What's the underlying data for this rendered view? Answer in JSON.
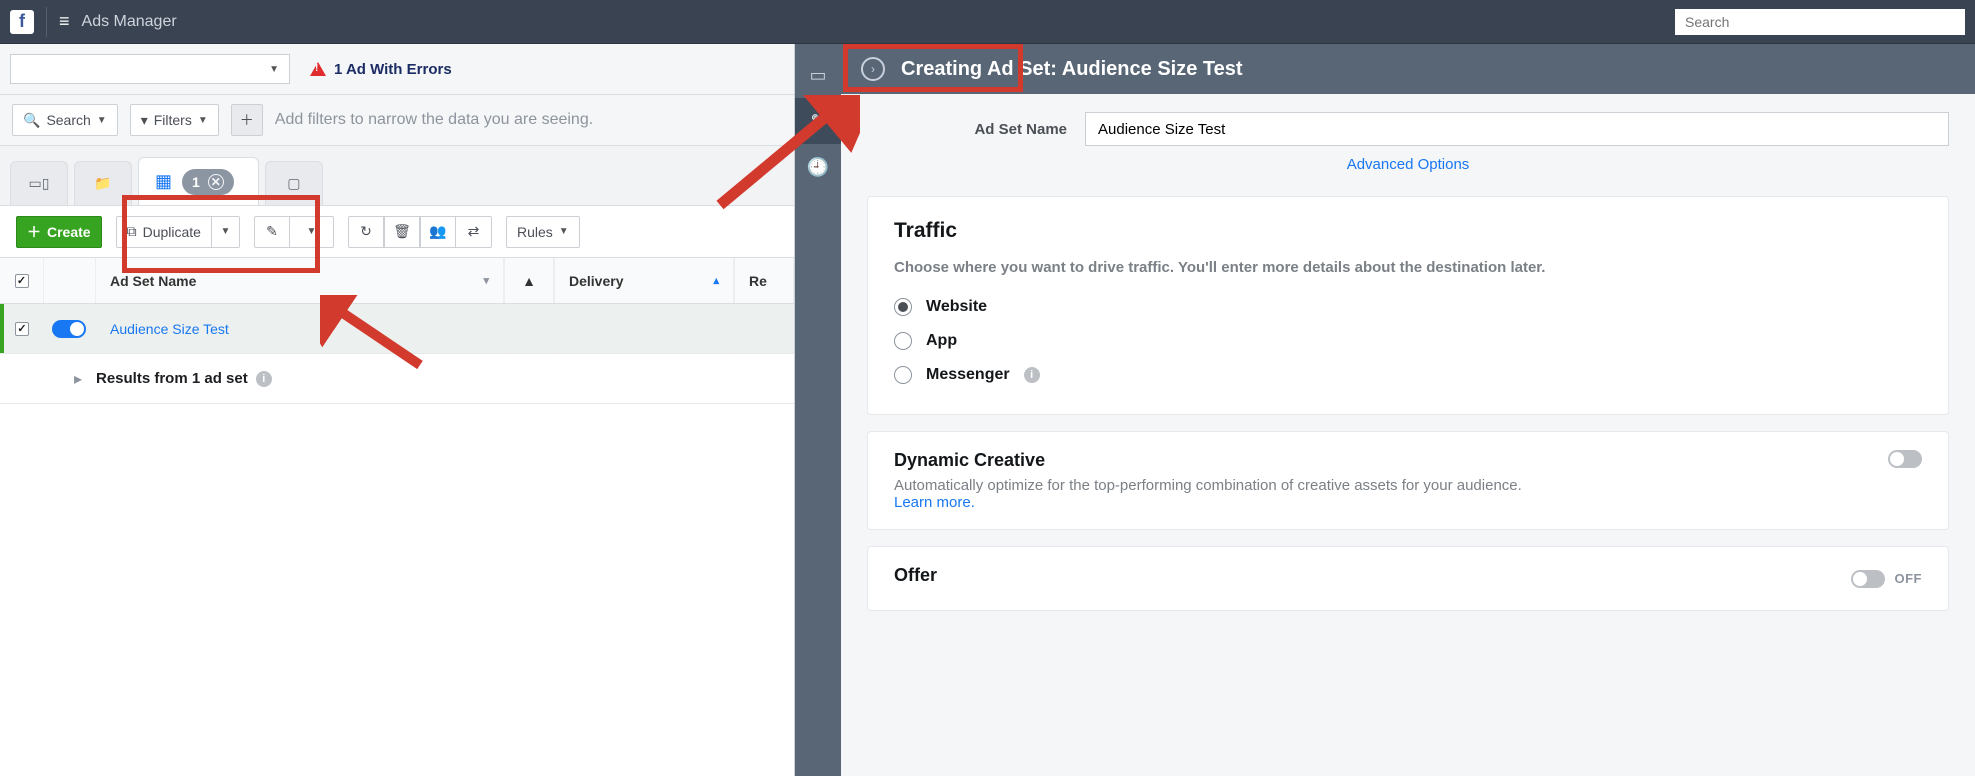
{
  "topnav": {
    "app_title": "Ads Manager",
    "search_placeholder": "Search"
  },
  "left": {
    "errors_text": "1 Ad With Errors",
    "search_btn": "Search",
    "filters_btn": "Filters",
    "filter_placeholder": "Add filters to narrow the data you are seeing.",
    "adset_tab_count": "1",
    "toolbar": {
      "create": "Create",
      "duplicate": "Duplicate",
      "rules": "Rules"
    },
    "columns": {
      "name": "Ad Set Name",
      "delivery": "Delivery",
      "re": "Re"
    },
    "rows": [
      {
        "name": "Audience Size Test",
        "checked": true,
        "toggle_on": true
      }
    ],
    "summary": "Results from 1 ad set"
  },
  "right": {
    "panel_title": "Creating Ad Set: Audience Size Test",
    "adset_name_label": "Ad Set Name",
    "adset_name_value": "Audience Size Test",
    "advanced_options": "Advanced Options",
    "traffic": {
      "heading": "Traffic",
      "desc": "Choose where you want to drive traffic. You'll enter more details about the destination later.",
      "options": [
        "Website",
        "App",
        "Messenger"
      ],
      "selected": "Website"
    },
    "dynamic": {
      "heading": "Dynamic Creative",
      "desc": "Automatically optimize for the top-performing combination of creative assets for your audience.",
      "learn_more": "Learn more.",
      "toggle_on": false
    },
    "offer": {
      "heading": "Offer",
      "state_label": "OFF",
      "toggle_on": false
    }
  }
}
